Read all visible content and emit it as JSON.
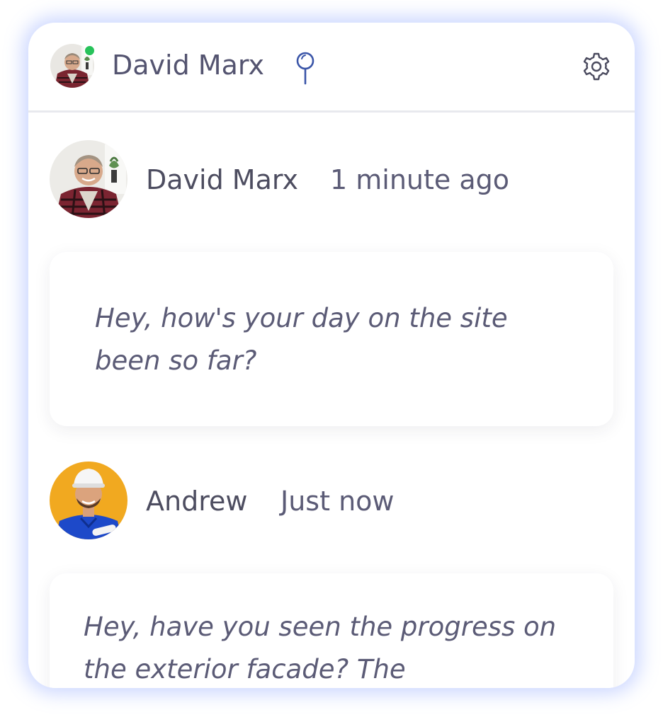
{
  "header": {
    "user_name": "David Marx",
    "online_color": "#27c25a",
    "pin_icon": "map-pin-icon",
    "settings_icon": "gear-icon"
  },
  "messages": [
    {
      "author": "David Marx",
      "time": "1 minute ago",
      "text": "Hey, how's your day on the site been so far?"
    },
    {
      "author": "Andrew",
      "time": "Just now",
      "text": "Hey, have you seen the progress on the exterior facade? The"
    }
  ],
  "colors": {
    "text": "#5b5b76",
    "accent": "#3a55a8",
    "divider": "#e8e9ee",
    "glow": "#7896ff"
  }
}
